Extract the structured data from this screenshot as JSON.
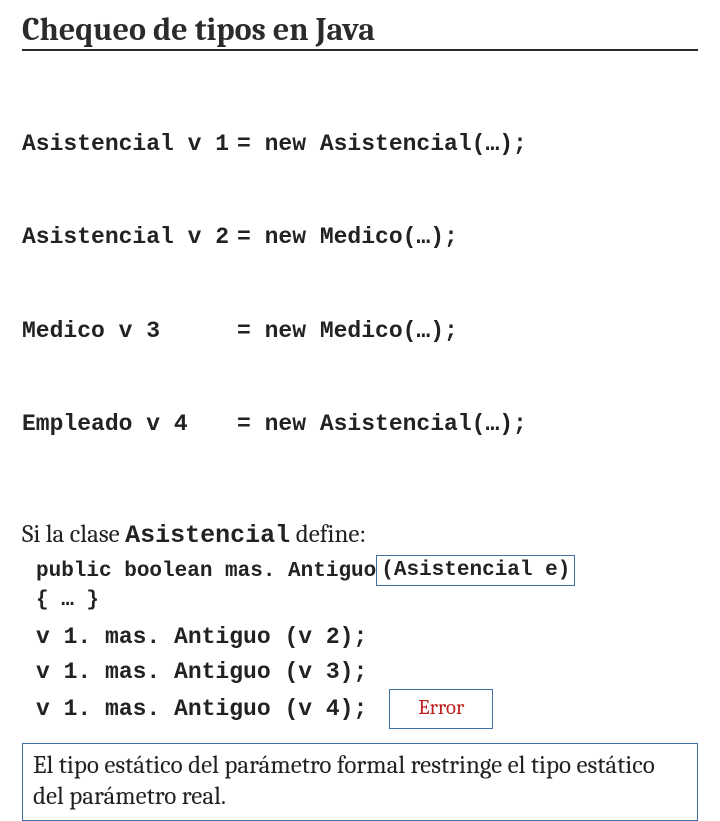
{
  "title": "Chequeo de tipos en Java",
  "decls": [
    {
      "lhs": "Asistencial v 1",
      "rhs": "= new Asistencial(…);"
    },
    {
      "lhs": "Asistencial v 2",
      "rhs": "= new Medico(…);"
    },
    {
      "lhs": "Medico v 3",
      "rhs": "= new Medico(…);"
    },
    {
      "lhs": "Empleado v 4",
      "rhs": "= new Asistencial(…);"
    }
  ],
  "defline": {
    "prefix": "Si la clase ",
    "class": "Asistencial",
    "suffix": " define:"
  },
  "method": {
    "sig_left": "public boolean mas. Antiguo",
    "sig_param": "(Asistencial e)",
    "body": "{ … }"
  },
  "calls": [
    {
      "text": "v 1. mas. Antiguo (v 2);",
      "error": false
    },
    {
      "text": "v 1. mas. Antiguo (v 3);",
      "error": false
    },
    {
      "text": "v 1. mas. Antiguo (v 4);",
      "error": true
    }
  ],
  "error_label": "Error",
  "conclusion": "El tipo estático del parámetro formal restringe el tipo estático del parámetro real."
}
